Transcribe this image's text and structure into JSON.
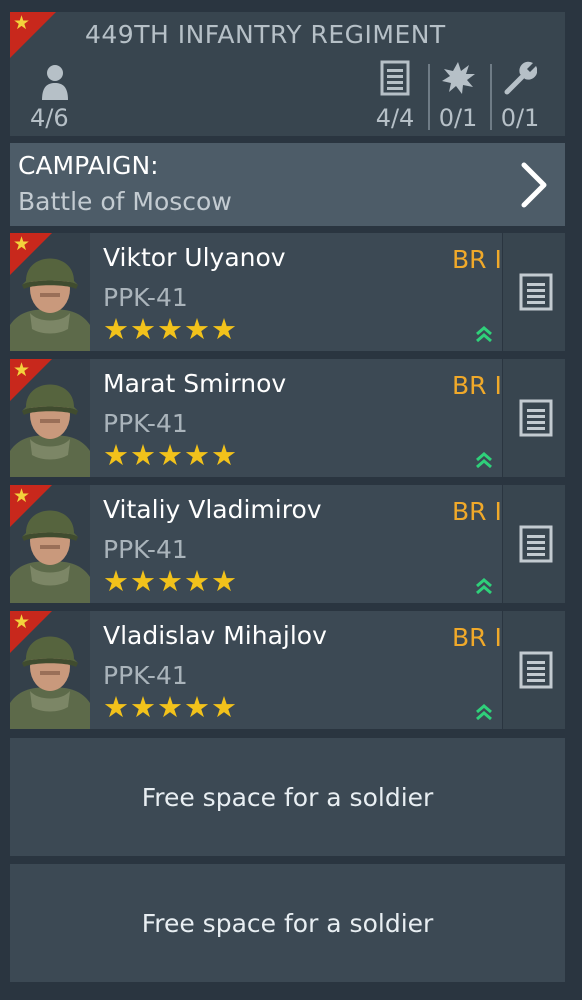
{
  "regiment": {
    "title": "449TH INFANTRY REGIMENT",
    "soldier_count": "4/6",
    "stats": [
      {
        "icon": "list-icon",
        "value": "4/4"
      },
      {
        "icon": "explosion-icon",
        "value": "0/1"
      },
      {
        "icon": "wrench-icon",
        "value": "0/1"
      }
    ]
  },
  "campaign": {
    "label": "CAMPAIGN:",
    "name": "Battle of Moscow"
  },
  "soldiers": [
    {
      "name": "Viktor Ulyanov",
      "weapon": "PPK-41",
      "br": "BR I",
      "stars": 5
    },
    {
      "name": "Marat Smirnov",
      "weapon": "PPK-41",
      "br": "BR I",
      "stars": 5
    },
    {
      "name": "Vitaliy Vladimirov",
      "weapon": "PPK-41",
      "br": "BR I",
      "stars": 5
    },
    {
      "name": "Vladislav Mihajlov",
      "weapon": "PPK-41",
      "br": "BR I",
      "stars": 5
    }
  ],
  "free_slots": [
    {
      "label": "Free space for a soldier"
    },
    {
      "label": "Free space for a soldier"
    }
  ],
  "colors": {
    "accent_red": "#c8281c",
    "star_gold": "#f2c21b",
    "br_orange": "#f0a92a",
    "rank_up_green": "#2fd07a"
  }
}
